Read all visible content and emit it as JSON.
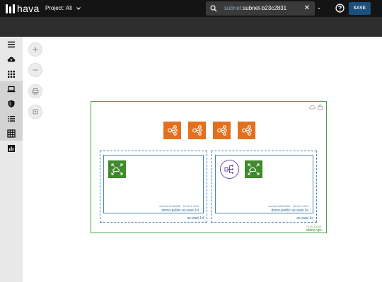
{
  "app": {
    "logo_text": "hava"
  },
  "toolbar": {
    "project_label": "Project: All",
    "search_prefix": "subnet:",
    "search_value": "subnet-b23c2831",
    "save_label": "SAVE"
  },
  "sidebar": {
    "items": [
      {
        "icon": "hamburger-menu-icon"
      },
      {
        "icon": "cloud-upload-icon"
      },
      {
        "icon": "apps-grid-icon"
      },
      {
        "icon": "laptop-icon"
      },
      {
        "icon": "shield-icon"
      },
      {
        "icon": "list-icon"
      },
      {
        "icon": "table-icon"
      },
      {
        "icon": "bar-chart-icon"
      }
    ]
  },
  "canvas_controls": [
    {
      "icon": "zoom-in-icon"
    },
    {
      "icon": "zoom-out-icon"
    },
    {
      "icon": "print-icon"
    },
    {
      "icon": "fit-to-screen-icon"
    }
  ],
  "diagram": {
    "vpc": {
      "cidr": "10.20.0.0/21",
      "name": "demo-vpc"
    },
    "availability_zones": [
      {
        "name": "us-east-1d",
        "subnet": {
          "id": "subnet-27e6f289 · 10.20.0.0/24",
          "name": "demo-public-us-east-1d"
        }
      },
      {
        "name": "us-east-1e",
        "subnet": {
          "id": "subnet-b23c2831 · 10.20.1.0/24",
          "name": "demo-public-us-east-1e"
        }
      }
    ]
  },
  "colors": {
    "topbar": "#141414",
    "subbar": "#2e2e2e",
    "save_button": "#1d4f7c",
    "vpc_border": "#4aa24a",
    "subnet_border": "#4a86b8",
    "resource_orange": "#e4701e",
    "resource_green": "#3f8a2a",
    "load_balancer": "#6a4ba6"
  }
}
